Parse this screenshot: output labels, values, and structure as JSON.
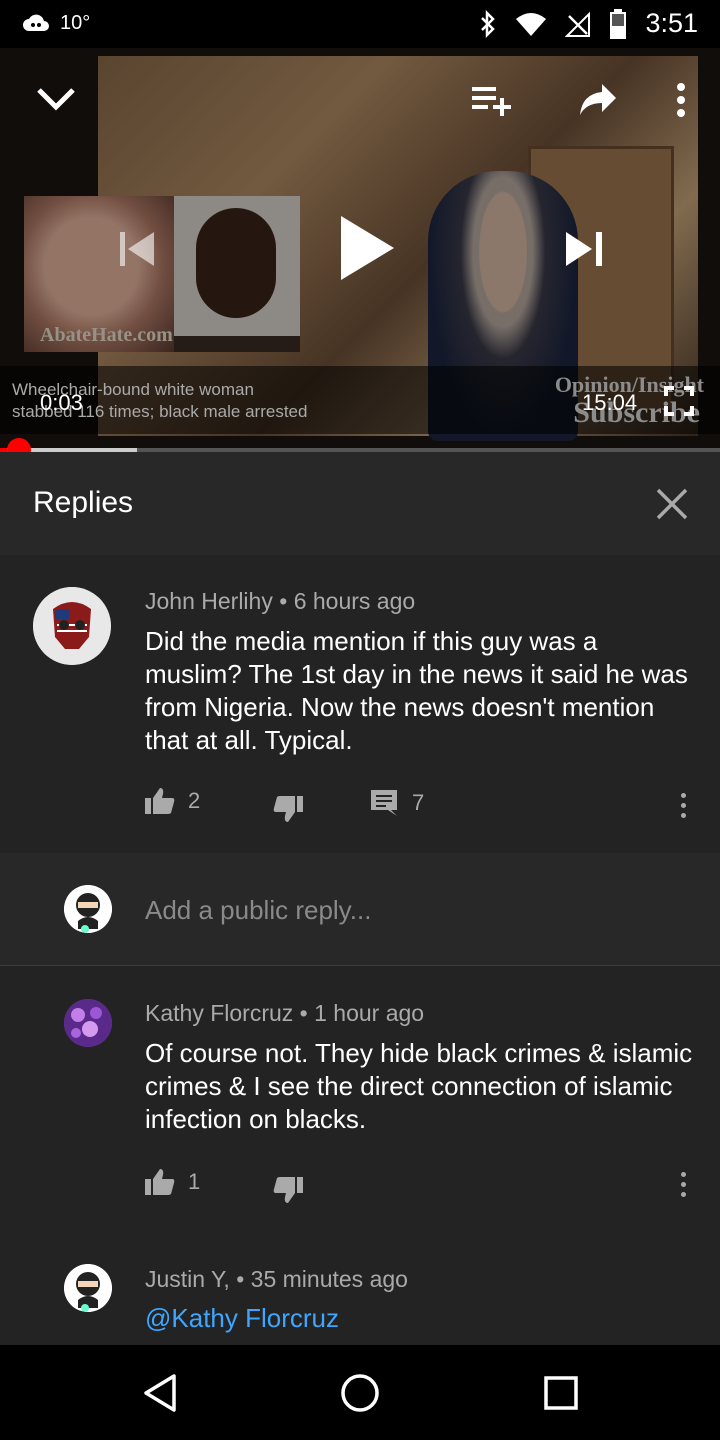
{
  "status_bar": {
    "temperature": "10°",
    "time": "3:51",
    "icons": [
      "weather-cloud-icon",
      "bluetooth-icon",
      "wifi-icon",
      "no-signal-icon",
      "battery-icon"
    ]
  },
  "player": {
    "caption_line1": "Wheelchair-bound white woman",
    "caption_line2": "stabbed 116 times; black male arrested",
    "current_time": "0:03",
    "duration": "15:04",
    "brand_line1": "Opinion/Insight",
    "brand_line2": "Subscribe",
    "inset_logo": "AbateHate.com",
    "progress_played": 0.01,
    "progress_loaded": 0.19,
    "accent_color": "#ff0000"
  },
  "replies": {
    "title": "Replies",
    "parent": {
      "author": "John Herlihy",
      "age": "6 hours ago",
      "text": "Did the media mention if this guy was a muslim?  The 1st day in the news it said he was from Nigeria.  Now the news doesn't mention that at all. Typical.",
      "likes": "2",
      "reply_count": "7"
    },
    "reply_input": {
      "placeholder": "Add a public reply..."
    },
    "items": [
      {
        "author": "Kathy Florcruz",
        "age": "1 hour ago",
        "text": "Of course not. They hide black crimes & islamic crimes & I see the direct connection of islamic infection on blacks.",
        "likes": "1"
      },
      {
        "author": "Justin Y,",
        "age": "35 minutes ago",
        "mention": "@Kathy Florcruz",
        "text": ""
      }
    ]
  },
  "colors": {
    "background": "#232323",
    "header": "#282828",
    "link": "#3ea6ff",
    "meta_text": "#aaaaaa"
  }
}
